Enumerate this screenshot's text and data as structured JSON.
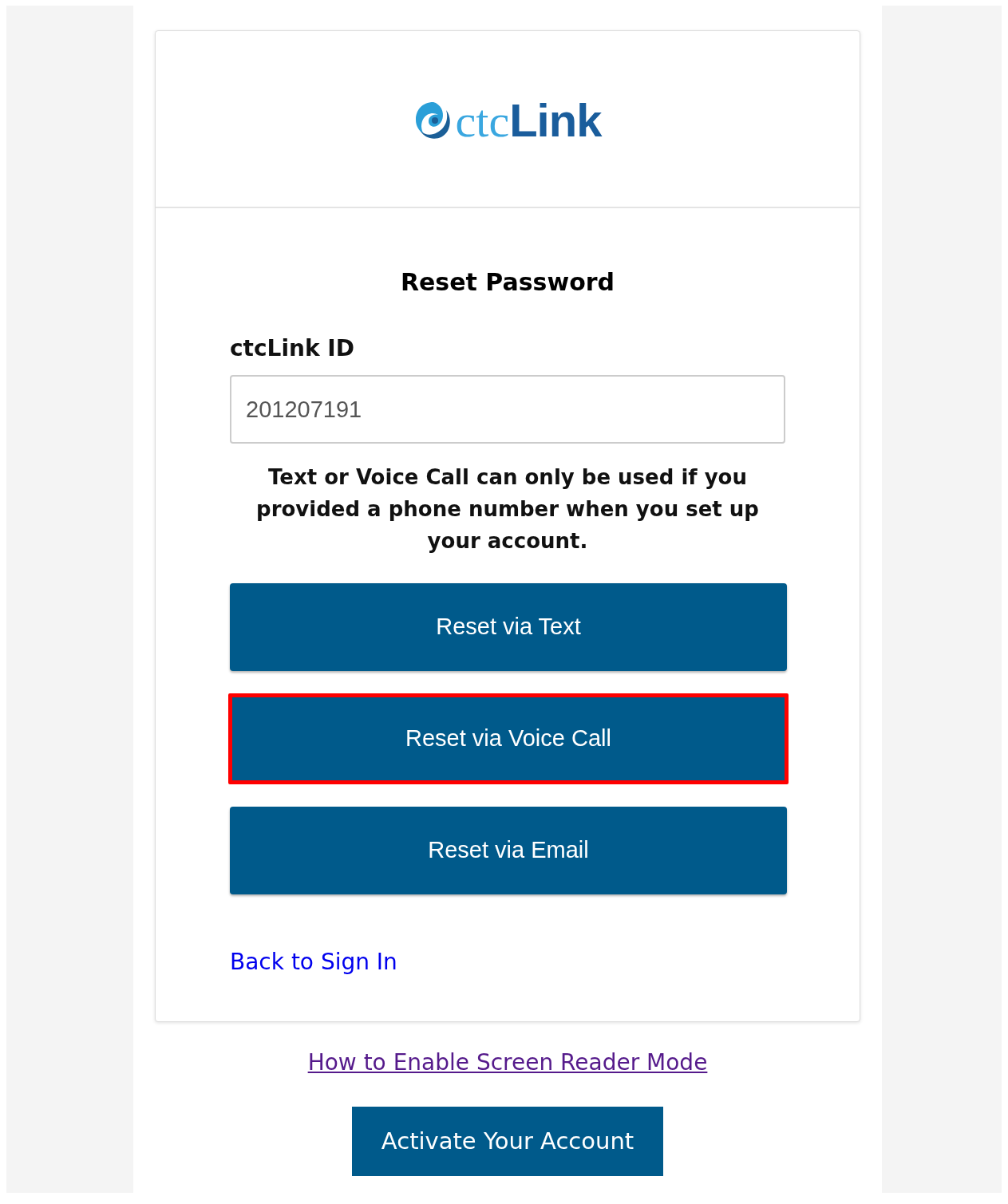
{
  "logo": {
    "prefix": "ctc",
    "suffix": "Link"
  },
  "title": "Reset Password",
  "id_field": {
    "label": "ctcLink ID",
    "value": "201207191"
  },
  "notice": "Text or Voice Call can only be used if you provided a phone number when you set up your account.",
  "reset_buttons": [
    {
      "label": "Reset via Text",
      "highlighted": false
    },
    {
      "label": "Reset via Voice Call",
      "highlighted": true
    },
    {
      "label": "Reset via Email",
      "highlighted": false
    }
  ],
  "back_link": "Back to Sign In",
  "screen_reader_link": "How to Enable Screen Reader Mode",
  "activate_button": "Activate Your Account"
}
